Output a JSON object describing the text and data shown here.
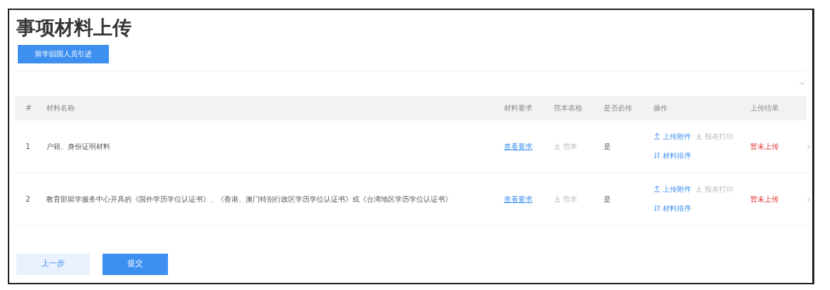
{
  "title": "事项材料上传",
  "category_button": {
    "label": "留学回国人员引进",
    "selected": true
  },
  "table": {
    "columns": [
      "#",
      "材料名称",
      "材料要求",
      "范本表格",
      "是否必传",
      "操作",
      "上传结果"
    ],
    "rows": [
      {
        "number": "1",
        "name": "户籍、身份证明材料",
        "requirement": "查看要求",
        "template": {
          "label": "范本",
          "disabled": true
        },
        "required": "是",
        "actions": [
          {
            "kind": "upload",
            "label": "上传附件",
            "disabled": false
          },
          {
            "kind": "download",
            "label": "报表打印",
            "disabled": true
          },
          {
            "kind": "sort",
            "label": "材料排序",
            "disabled": false
          }
        ],
        "result": "暂未上传"
      },
      {
        "number": "2",
        "name": "教育部留学服务中心开具的《国外学历学位认证书》、《香港、澳门特别行政区学历学位认证书》或《台湾地区学历学位认证书》",
        "requirement": "查看要求",
        "template": {
          "label": "范本",
          "disabled": true
        },
        "required": "是",
        "actions": [
          {
            "kind": "upload",
            "label": "上传附件",
            "disabled": false
          },
          {
            "kind": "download",
            "label": "报表打印",
            "disabled": true
          },
          {
            "kind": "sort",
            "label": "材料排序",
            "disabled": false
          }
        ],
        "result": "暂未上传"
      }
    ]
  },
  "buttons": [
    {
      "kind": "secondary",
      "label": "上一步"
    },
    {
      "kind": "primary",
      "label": "提交"
    }
  ]
}
